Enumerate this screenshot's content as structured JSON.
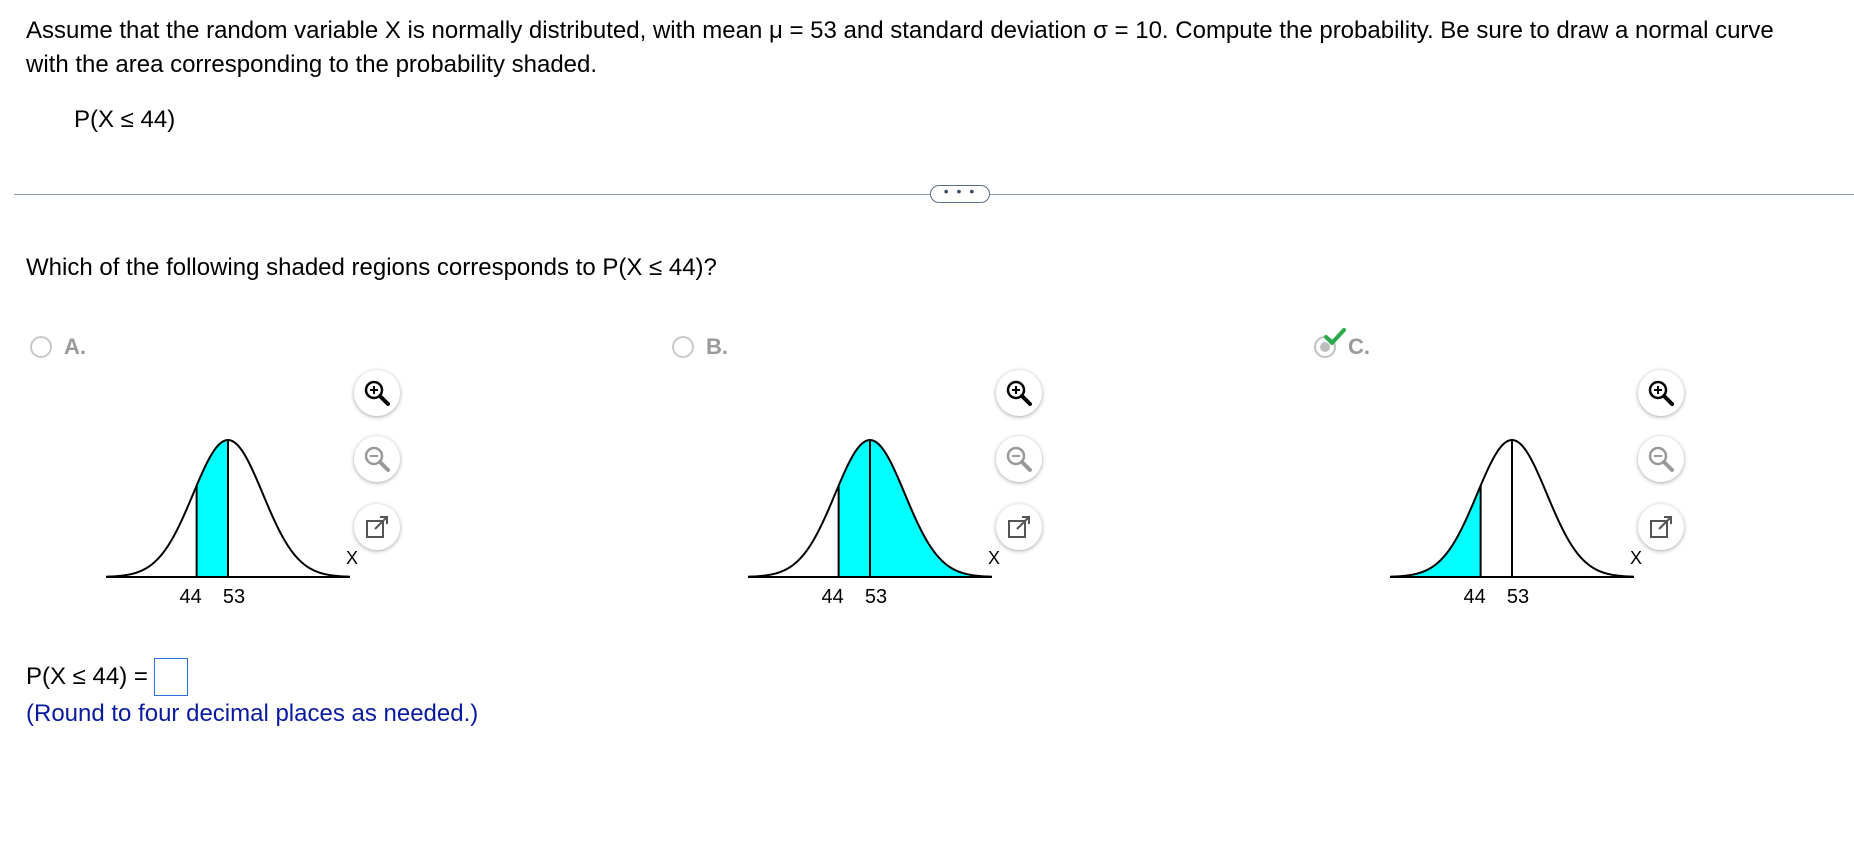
{
  "prompt": {
    "line1": "Assume that the random variable X is normally distributed, with mean μ = 53 and standard deviation σ = 10. Compute the probability. Be sure to draw a normal curve",
    "line2": "with the area corresponding to the probability shaded.",
    "expression": "P(X ≤ 44)"
  },
  "expand_button": "• • •",
  "question": "Which of the following shaded regions corresponds to P(X ≤ 44)?",
  "options": [
    {
      "letter": "A.",
      "selected": false,
      "shading": "between 44 and 53",
      "axis_label": "X",
      "ticks": [
        "44",
        "53"
      ],
      "shade_color": "#00ffff"
    },
    {
      "letter": "B.",
      "selected": false,
      "shading": "right of 44",
      "axis_label": "X",
      "ticks": [
        "44",
        "53"
      ],
      "shade_color": "#00ffff"
    },
    {
      "letter": "C.",
      "selected": true,
      "shading": "left of 44",
      "axis_label": "X",
      "ticks": [
        "44",
        "53"
      ],
      "shade_color": "#00ffff"
    }
  ],
  "tools": [
    "zoom-in-icon",
    "zoom-out-icon",
    "popout-icon"
  ],
  "answer": {
    "label": "P(X ≤ 44) =",
    "value": ""
  },
  "hint": "(Round to four decimal places as needed.)",
  "colors": {
    "check": "#2aa84a",
    "hint": "#0a1aa0",
    "input_border": "#2f6fe0"
  }
}
